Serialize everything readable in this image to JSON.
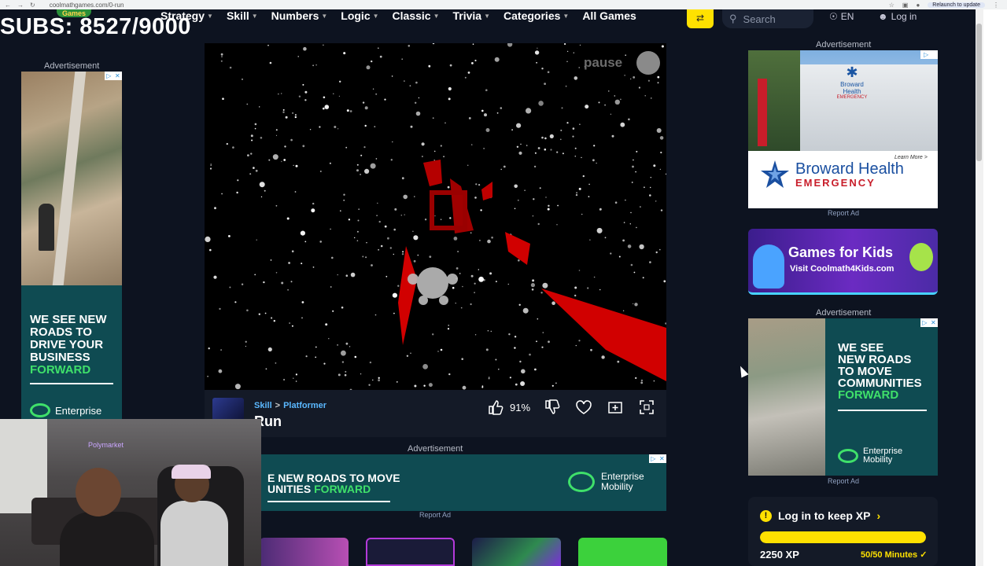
{
  "browser": {
    "url": "coolmathgames.com/0-run",
    "relaunch_label": "Relaunch to update"
  },
  "site": {
    "logo_text": "Games",
    "menu": [
      "Strategy",
      "Skill",
      "Numbers",
      "Logic",
      "Classic",
      "Trivia",
      "Categories",
      "All Games"
    ],
    "search_placeholder": "Search",
    "language": "EN",
    "login": "Log in"
  },
  "stream_overlay": {
    "subs_text": "SUBS: 8527/9000"
  },
  "left_ad": {
    "label": "Advertisement",
    "copy_lines": [
      "WE SEE NEW",
      "ROADS TO",
      "DRIVE YOUR",
      "BUSINESS"
    ],
    "copy_green": "FORWARD",
    "brand": "Enterprise"
  },
  "game": {
    "pause_label": "pause",
    "breadcrumb_category": "Skill",
    "breadcrumb_sep": ">",
    "breadcrumb_sub": "Platformer",
    "title": "Run",
    "rating": "91%"
  },
  "bottom_ad": {
    "label": "Advertisement",
    "line1": "E NEW ROADS TO MOVE",
    "line2_white": "UNITIES ",
    "line2_green": "FORWARD",
    "brand_line1": "Enterprise",
    "brand_line2": "Mobility",
    "report": "Report Ad"
  },
  "right_ad1": {
    "label": "Advertisement",
    "sign_line1": "Broward",
    "sign_line2": "Health",
    "sign_line3": "EMERGENCY",
    "learn_more": "Learn More >",
    "brand_name": "Broward Health",
    "brand_sub": "EMERGENCY",
    "side_sign": "EMERGENCY",
    "report": "Report Ad"
  },
  "kids_ad": {
    "title": "Games for Kids",
    "url": "Visit Coolmath4Kids.com"
  },
  "right_ad2": {
    "label": "Advertisement",
    "copy_lines": [
      "WE SEE",
      "NEW ROADS",
      "TO MOVE",
      "COMMUNITIES"
    ],
    "copy_green": "FORWARD",
    "brand_line1": "Enterprise",
    "brand_line2": "Mobility",
    "report": "Report Ad"
  },
  "xp_card": {
    "heading": "Log in to keep XP",
    "xp": "2250 XP",
    "minutes": "50/50 Minutes",
    "progress": 1.0
  },
  "webcam": {
    "neon_sign": "Polymarket"
  },
  "colors": {
    "accent_yellow": "#ffe100",
    "link_blue": "#5ab8ff",
    "ad_teal": "#0f4b52",
    "ad_green": "#3fe06a",
    "game_red": "#d10000"
  }
}
